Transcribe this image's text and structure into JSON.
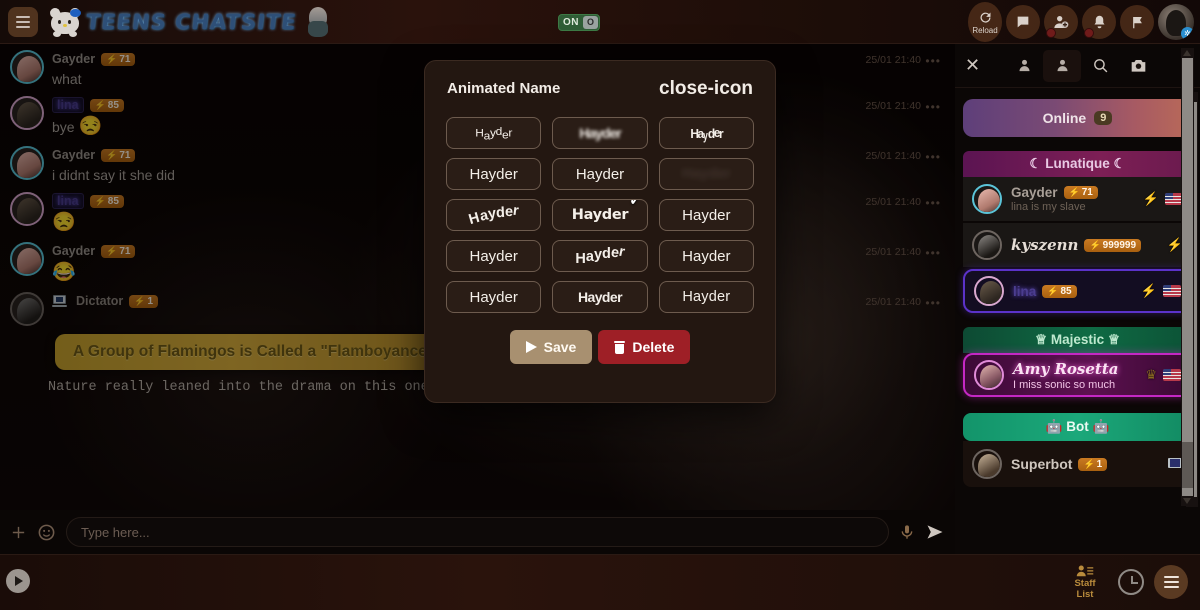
{
  "topbar": {
    "menu_icon": "hamburger-icon",
    "logo_text": "TEENS CHATSITE",
    "toggle": {
      "label": "ON",
      "knob": "O"
    },
    "actions": [
      {
        "name": "reload",
        "label": "Reload",
        "icon": "reload-icon"
      },
      {
        "name": "messages",
        "label": "",
        "icon": "message-icon"
      },
      {
        "name": "add-friend",
        "label": "",
        "icon": "add-user-icon"
      },
      {
        "name": "notifications",
        "label": "",
        "icon": "bell-icon"
      },
      {
        "name": "reports",
        "label": "",
        "icon": "flag-icon"
      }
    ],
    "avatar_badge": "✲"
  },
  "chat": {
    "messages": [
      {
        "user": "Gayder",
        "style": "plain",
        "points": "71",
        "text": "what",
        "emoji": "",
        "timestamp": "25/01 21:40",
        "menu": "•••"
      },
      {
        "user": "lina",
        "style": "lina",
        "points": "85",
        "text": "bye",
        "emoji": "😒",
        "timestamp": "25/01 21:40",
        "menu": "•••"
      },
      {
        "user": "Gayder",
        "style": "plain",
        "points": "71",
        "text": "i didnt say it she did",
        "emoji": "",
        "timestamp": "25/01 21:40",
        "menu": "•••"
      },
      {
        "user": "lina",
        "style": "lina",
        "points": "85",
        "text": "",
        "emoji": "😒",
        "timestamp": "25/01 21:40",
        "menu": "•••"
      },
      {
        "user": "Gayder",
        "style": "plain",
        "points": "71",
        "text": "",
        "emoji": "😂",
        "timestamp": "25/01 21:40",
        "menu": "•••"
      },
      {
        "user": "Dictator",
        "style": "dict",
        "points": "1",
        "text": "",
        "emoji": "",
        "timestamp": "25/01 21:40",
        "menu": "•••"
      }
    ],
    "fact_banner": "A Group of Flamingos is Called a \"Flamboyance\"",
    "fact_sub": "Nature really leaned into the drama on this one."
  },
  "input": {
    "plus_icon": "plus-icon",
    "emoji_icon": "emoji-icon",
    "placeholder": "Type here...",
    "mic_icon": "microphone-icon",
    "send_icon": "send-icon"
  },
  "modal": {
    "title": "Animated Name",
    "close_icon": "close-icon",
    "preview_name": "Hayder",
    "selected_index": 7,
    "styles": [
      {
        "index": 0,
        "effect": "wobble"
      },
      {
        "index": 1,
        "effect": "blur"
      },
      {
        "index": 2,
        "effect": "squeeze"
      },
      {
        "index": 3,
        "effect": "plain"
      },
      {
        "index": 4,
        "effect": "plain"
      },
      {
        "index": 5,
        "effect": "fade"
      },
      {
        "index": 6,
        "effect": "arc"
      },
      {
        "index": 7,
        "effect": "bold"
      },
      {
        "index": 8,
        "effect": "plain"
      },
      {
        "index": 9,
        "effect": "plain"
      },
      {
        "index": 10,
        "effect": "wave"
      },
      {
        "index": 11,
        "effect": "plain"
      },
      {
        "index": 12,
        "effect": "plain"
      },
      {
        "index": 13,
        "effect": "narrow"
      },
      {
        "index": 14,
        "effect": "light"
      }
    ],
    "save_label": "Save",
    "delete_label": "Delete"
  },
  "right_panel": {
    "close_icon": "close-icon",
    "tools": [
      {
        "name": "user-icon-1"
      },
      {
        "name": "user-icon-2"
      },
      {
        "name": "search-icon"
      },
      {
        "name": "camera-icon"
      }
    ],
    "online_label": "Online",
    "online_count": "9",
    "groups": [
      {
        "name": "Lunatique",
        "header_text": "☾ Lunatique ☾",
        "theme": "lun",
        "members": [
          {
            "name": "Gayder",
            "style": "plain",
            "points": "71",
            "status": "lina is my slave",
            "flag": true,
            "bolt": true
          },
          {
            "name": "kyszenn",
            "style": "kys",
            "points": "999999",
            "status": "",
            "flag": false,
            "bolt": true
          },
          {
            "name": "lina",
            "style": "lina",
            "points": "85",
            "status": "",
            "flag": true,
            "bolt": true,
            "selected": true
          }
        ]
      },
      {
        "name": "Majestic",
        "header_text": "♕ Majestic ♕",
        "theme": "maj",
        "members": [
          {
            "name": "Amy Rosetta",
            "style": "amy",
            "points": "",
            "status": "I miss sonic so much",
            "flag": true,
            "bolt": false
          }
        ]
      },
      {
        "name": "Bot",
        "header_text": "🤖 Bot 🤖",
        "theme": "bot",
        "members": [
          {
            "name": "Superbot",
            "style": "sbot",
            "points": "1",
            "status": "",
            "flag": false,
            "bolt": false,
            "pc": true
          }
        ]
      }
    ],
    "footer": {
      "staff_list_line1": "Staff",
      "staff_list_line2": "List",
      "clock_icon": "clock-icon",
      "menu_icon": "hamburger-icon"
    }
  },
  "bottom": {
    "play_icon": "play-icon"
  },
  "colors": {
    "accent_orange": "#c97a22",
    "save_button": "#a89070",
    "delete_button": "#9e1f26",
    "modal_bg": "#231711",
    "selected_purple": "#5b32c9",
    "majestic_magenta": "#c428c4"
  }
}
